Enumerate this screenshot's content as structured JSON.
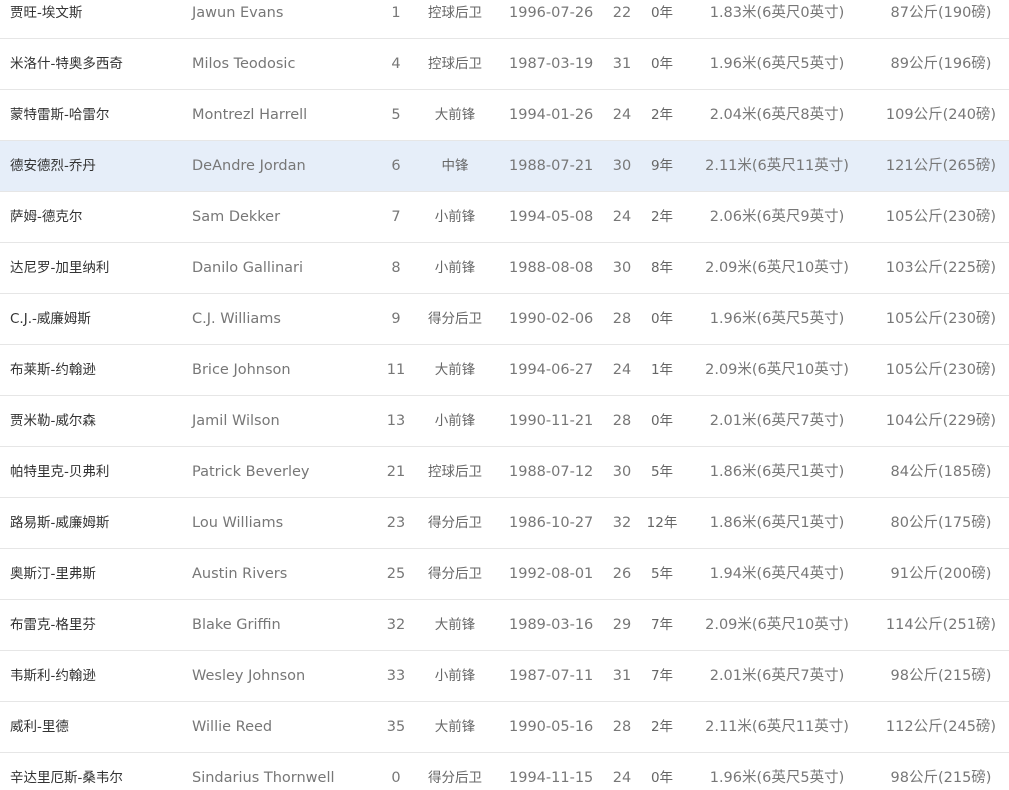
{
  "roster": {
    "players": [
      {
        "name_cn": "贾旺-埃文斯",
        "name_en": "Jawun Evans",
        "number": "1",
        "position": "控球后卫",
        "birthdate": "1996-07-26",
        "age": "22",
        "experience": "0年",
        "height": "1.83米(6英尺0英寸)",
        "weight": "87公斤(190磅)"
      },
      {
        "name_cn": "米洛什-特奥多西奇",
        "name_en": "Milos Teodosic",
        "number": "4",
        "position": "控球后卫",
        "birthdate": "1987-03-19",
        "age": "31",
        "experience": "0年",
        "height": "1.96米(6英尺5英寸)",
        "weight": "89公斤(196磅)"
      },
      {
        "name_cn": "蒙特雷斯-哈雷尔",
        "name_en": "Montrezl Harrell",
        "number": "5",
        "position": "大前锋",
        "birthdate": "1994-01-26",
        "age": "24",
        "experience": "2年",
        "height": "2.04米(6英尺8英寸)",
        "weight": "109公斤(240磅)"
      },
      {
        "name_cn": "德安德烈-乔丹",
        "name_en": "DeAndre Jordan",
        "number": "6",
        "position": "中锋",
        "birthdate": "1988-07-21",
        "age": "30",
        "experience": "9年",
        "height": "2.11米(6英尺11英寸)",
        "weight": "121公斤(265磅)"
      },
      {
        "name_cn": "萨姆-德克尔",
        "name_en": "Sam Dekker",
        "number": "7",
        "position": "小前锋",
        "birthdate": "1994-05-08",
        "age": "24",
        "experience": "2年",
        "height": "2.06米(6英尺9英寸)",
        "weight": "105公斤(230磅)"
      },
      {
        "name_cn": "达尼罗-加里纳利",
        "name_en": "Danilo Gallinari",
        "number": "8",
        "position": "小前锋",
        "birthdate": "1988-08-08",
        "age": "30",
        "experience": "8年",
        "height": "2.09米(6英尺10英寸)",
        "weight": "103公斤(225磅)"
      },
      {
        "name_cn": "C.J.-威廉姆斯",
        "name_en": "C.J. Williams",
        "number": "9",
        "position": "得分后卫",
        "birthdate": "1990-02-06",
        "age": "28",
        "experience": "0年",
        "height": "1.96米(6英尺5英寸)",
        "weight": "105公斤(230磅)"
      },
      {
        "name_cn": "布莱斯-约翰逊",
        "name_en": "Brice Johnson",
        "number": "11",
        "position": "大前锋",
        "birthdate": "1994-06-27",
        "age": "24",
        "experience": "1年",
        "height": "2.09米(6英尺10英寸)",
        "weight": "105公斤(230磅)"
      },
      {
        "name_cn": "贾米勒-威尔森",
        "name_en": "Jamil Wilson",
        "number": "13",
        "position": "小前锋",
        "birthdate": "1990-11-21",
        "age": "28",
        "experience": "0年",
        "height": "2.01米(6英尺7英寸)",
        "weight": "104公斤(229磅)"
      },
      {
        "name_cn": "帕特里克-贝弗利",
        "name_en": "Patrick Beverley",
        "number": "21",
        "position": "控球后卫",
        "birthdate": "1988-07-12",
        "age": "30",
        "experience": "5年",
        "height": "1.86米(6英尺1英寸)",
        "weight": "84公斤(185磅)"
      },
      {
        "name_cn": "路易斯-威廉姆斯",
        "name_en": "Lou Williams",
        "number": "23",
        "position": "得分后卫",
        "birthdate": "1986-10-27",
        "age": "32",
        "experience": "12年",
        "height": "1.86米(6英尺1英寸)",
        "weight": "80公斤(175磅)"
      },
      {
        "name_cn": "奥斯汀-里弗斯",
        "name_en": "Austin Rivers",
        "number": "25",
        "position": "得分后卫",
        "birthdate": "1992-08-01",
        "age": "26",
        "experience": "5年",
        "height": "1.94米(6英尺4英寸)",
        "weight": "91公斤(200磅)"
      },
      {
        "name_cn": "布雷克-格里芬",
        "name_en": "Blake Griffin",
        "number": "32",
        "position": "大前锋",
        "birthdate": "1989-03-16",
        "age": "29",
        "experience": "7年",
        "height": "2.09米(6英尺10英寸)",
        "weight": "114公斤(251磅)"
      },
      {
        "name_cn": "韦斯利-约翰逊",
        "name_en": "Wesley Johnson",
        "number": "33",
        "position": "小前锋",
        "birthdate": "1987-07-11",
        "age": "31",
        "experience": "7年",
        "height": "2.01米(6英尺7英寸)",
        "weight": "98公斤(215磅)"
      },
      {
        "name_cn": "威利-里德",
        "name_en": "Willie Reed",
        "number": "35",
        "position": "大前锋",
        "birthdate": "1990-05-16",
        "age": "28",
        "experience": "2年",
        "height": "2.11米(6英尺11英寸)",
        "weight": "112公斤(245磅)"
      },
      {
        "name_cn": "辛达里厄斯-桑韦尔",
        "name_en": "Sindarius Thornwell",
        "number": "0",
        "position": "得分后卫",
        "birthdate": "1994-11-15",
        "age": "24",
        "experience": "0年",
        "height": "1.96米(6英尺5英寸)",
        "weight": "98公斤(215磅)"
      }
    ],
    "highlighted_row": 3,
    "colors": {
      "highlight_bg": "#e6eef9",
      "row_border": "#e6e6e6",
      "text_dark": "#333333",
      "text_muted": "#777777"
    }
  }
}
